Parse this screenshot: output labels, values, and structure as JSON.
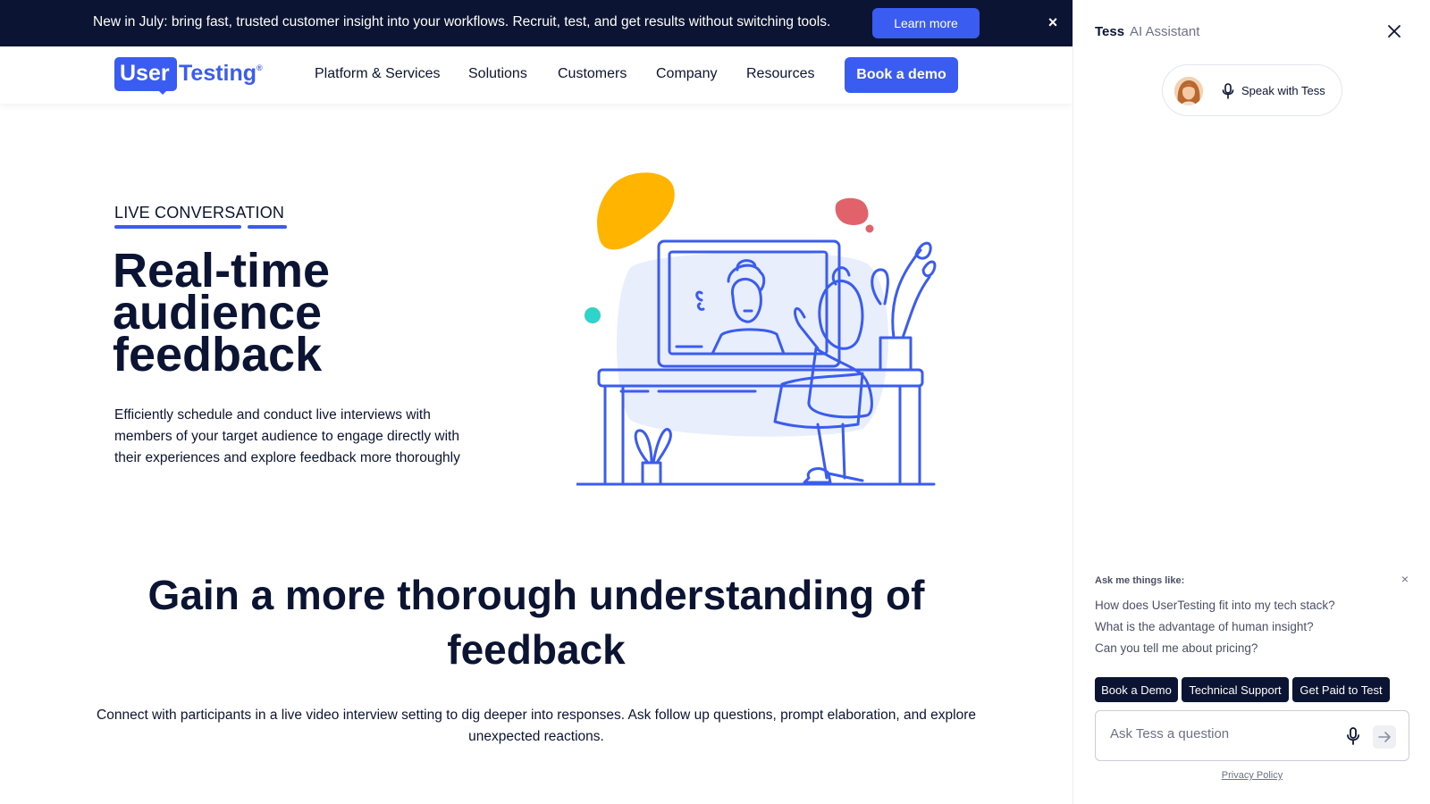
{
  "banner": {
    "text": "New in July: bring fast, trusted customer insight into your workflows. Recruit, test, and get results without switching tools.",
    "button_label": "Learn more",
    "close_symbol": "×"
  },
  "nav": {
    "logo_user": "User",
    "logo_testing": "Testing",
    "logo_reg": "®",
    "items": [
      "Platform & Services",
      "Solutions",
      "Customers",
      "Company",
      "Resources"
    ],
    "cta_label": "Book a demo"
  },
  "hero": {
    "eyebrow": "LIVE CONVERSATION",
    "title_lines": [
      "Real-time",
      "audience",
      "feedback"
    ],
    "description": "Efficiently schedule and conduct live interviews with members of your target audience to engage directly with their experiences and explore feedback more thoroughly"
  },
  "section": {
    "title": "Gain a more thorough understanding of feedback",
    "description": "Connect with participants in a live video interview setting to dig deeper into responses. Ask follow up questions, prompt elaboration, and explore unexpected reactions."
  },
  "assistant": {
    "name": "Tess",
    "role": "AI Assistant",
    "speak_label": "Speak with Tess",
    "ask_heading": "Ask me things like:",
    "ask_close": "×",
    "suggestions": [
      "How does UserTesting fit into my tech stack?",
      "What is the advantage of human insight?",
      "Can you tell me about pricing?"
    ],
    "chips": [
      "Book a Demo",
      "Technical Support",
      "Get Paid to Test"
    ],
    "input_placeholder": "Ask Tess a question",
    "privacy_label": "Privacy Policy"
  },
  "colors": {
    "navy": "#0b1533",
    "brand_blue": "#3b5cf0",
    "illustration_yellow": "#ffb400",
    "illustration_pink": "#e2626b",
    "illustration_teal": "#2fd3c9",
    "illustration_bg": "#e8eefc"
  }
}
